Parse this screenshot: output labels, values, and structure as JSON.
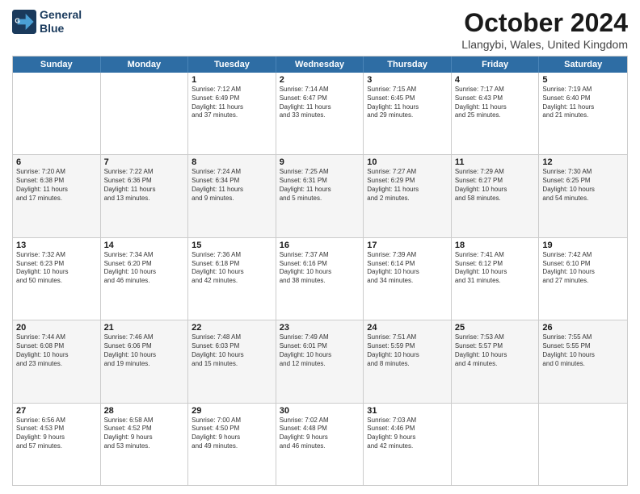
{
  "header": {
    "logo_line1": "General",
    "logo_line2": "Blue",
    "title": "October 2024",
    "location": "Llangybi, Wales, United Kingdom"
  },
  "days_of_week": [
    "Sunday",
    "Monday",
    "Tuesday",
    "Wednesday",
    "Thursday",
    "Friday",
    "Saturday"
  ],
  "rows": [
    {
      "alt": false,
      "cells": [
        {
          "day": "",
          "detail": ""
        },
        {
          "day": "",
          "detail": ""
        },
        {
          "day": "1",
          "detail": "Sunrise: 7:12 AM\nSunset: 6:49 PM\nDaylight: 11 hours\nand 37 minutes."
        },
        {
          "day": "2",
          "detail": "Sunrise: 7:14 AM\nSunset: 6:47 PM\nDaylight: 11 hours\nand 33 minutes."
        },
        {
          "day": "3",
          "detail": "Sunrise: 7:15 AM\nSunset: 6:45 PM\nDaylight: 11 hours\nand 29 minutes."
        },
        {
          "day": "4",
          "detail": "Sunrise: 7:17 AM\nSunset: 6:43 PM\nDaylight: 11 hours\nand 25 minutes."
        },
        {
          "day": "5",
          "detail": "Sunrise: 7:19 AM\nSunset: 6:40 PM\nDaylight: 11 hours\nand 21 minutes."
        }
      ]
    },
    {
      "alt": true,
      "cells": [
        {
          "day": "6",
          "detail": "Sunrise: 7:20 AM\nSunset: 6:38 PM\nDaylight: 11 hours\nand 17 minutes."
        },
        {
          "day": "7",
          "detail": "Sunrise: 7:22 AM\nSunset: 6:36 PM\nDaylight: 11 hours\nand 13 minutes."
        },
        {
          "day": "8",
          "detail": "Sunrise: 7:24 AM\nSunset: 6:34 PM\nDaylight: 11 hours\nand 9 minutes."
        },
        {
          "day": "9",
          "detail": "Sunrise: 7:25 AM\nSunset: 6:31 PM\nDaylight: 11 hours\nand 5 minutes."
        },
        {
          "day": "10",
          "detail": "Sunrise: 7:27 AM\nSunset: 6:29 PM\nDaylight: 11 hours\nand 2 minutes."
        },
        {
          "day": "11",
          "detail": "Sunrise: 7:29 AM\nSunset: 6:27 PM\nDaylight: 10 hours\nand 58 minutes."
        },
        {
          "day": "12",
          "detail": "Sunrise: 7:30 AM\nSunset: 6:25 PM\nDaylight: 10 hours\nand 54 minutes."
        }
      ]
    },
    {
      "alt": false,
      "cells": [
        {
          "day": "13",
          "detail": "Sunrise: 7:32 AM\nSunset: 6:23 PM\nDaylight: 10 hours\nand 50 minutes."
        },
        {
          "day": "14",
          "detail": "Sunrise: 7:34 AM\nSunset: 6:20 PM\nDaylight: 10 hours\nand 46 minutes."
        },
        {
          "day": "15",
          "detail": "Sunrise: 7:36 AM\nSunset: 6:18 PM\nDaylight: 10 hours\nand 42 minutes."
        },
        {
          "day": "16",
          "detail": "Sunrise: 7:37 AM\nSunset: 6:16 PM\nDaylight: 10 hours\nand 38 minutes."
        },
        {
          "day": "17",
          "detail": "Sunrise: 7:39 AM\nSunset: 6:14 PM\nDaylight: 10 hours\nand 34 minutes."
        },
        {
          "day": "18",
          "detail": "Sunrise: 7:41 AM\nSunset: 6:12 PM\nDaylight: 10 hours\nand 31 minutes."
        },
        {
          "day": "19",
          "detail": "Sunrise: 7:42 AM\nSunset: 6:10 PM\nDaylight: 10 hours\nand 27 minutes."
        }
      ]
    },
    {
      "alt": true,
      "cells": [
        {
          "day": "20",
          "detail": "Sunrise: 7:44 AM\nSunset: 6:08 PM\nDaylight: 10 hours\nand 23 minutes."
        },
        {
          "day": "21",
          "detail": "Sunrise: 7:46 AM\nSunset: 6:06 PM\nDaylight: 10 hours\nand 19 minutes."
        },
        {
          "day": "22",
          "detail": "Sunrise: 7:48 AM\nSunset: 6:03 PM\nDaylight: 10 hours\nand 15 minutes."
        },
        {
          "day": "23",
          "detail": "Sunrise: 7:49 AM\nSunset: 6:01 PM\nDaylight: 10 hours\nand 12 minutes."
        },
        {
          "day": "24",
          "detail": "Sunrise: 7:51 AM\nSunset: 5:59 PM\nDaylight: 10 hours\nand 8 minutes."
        },
        {
          "day": "25",
          "detail": "Sunrise: 7:53 AM\nSunset: 5:57 PM\nDaylight: 10 hours\nand 4 minutes."
        },
        {
          "day": "26",
          "detail": "Sunrise: 7:55 AM\nSunset: 5:55 PM\nDaylight: 10 hours\nand 0 minutes."
        }
      ]
    },
    {
      "alt": false,
      "cells": [
        {
          "day": "27",
          "detail": "Sunrise: 6:56 AM\nSunset: 4:53 PM\nDaylight: 9 hours\nand 57 minutes."
        },
        {
          "day": "28",
          "detail": "Sunrise: 6:58 AM\nSunset: 4:52 PM\nDaylight: 9 hours\nand 53 minutes."
        },
        {
          "day": "29",
          "detail": "Sunrise: 7:00 AM\nSunset: 4:50 PM\nDaylight: 9 hours\nand 49 minutes."
        },
        {
          "day": "30",
          "detail": "Sunrise: 7:02 AM\nSunset: 4:48 PM\nDaylight: 9 hours\nand 46 minutes."
        },
        {
          "day": "31",
          "detail": "Sunrise: 7:03 AM\nSunset: 4:46 PM\nDaylight: 9 hours\nand 42 minutes."
        },
        {
          "day": "",
          "detail": ""
        },
        {
          "day": "",
          "detail": ""
        }
      ]
    }
  ]
}
